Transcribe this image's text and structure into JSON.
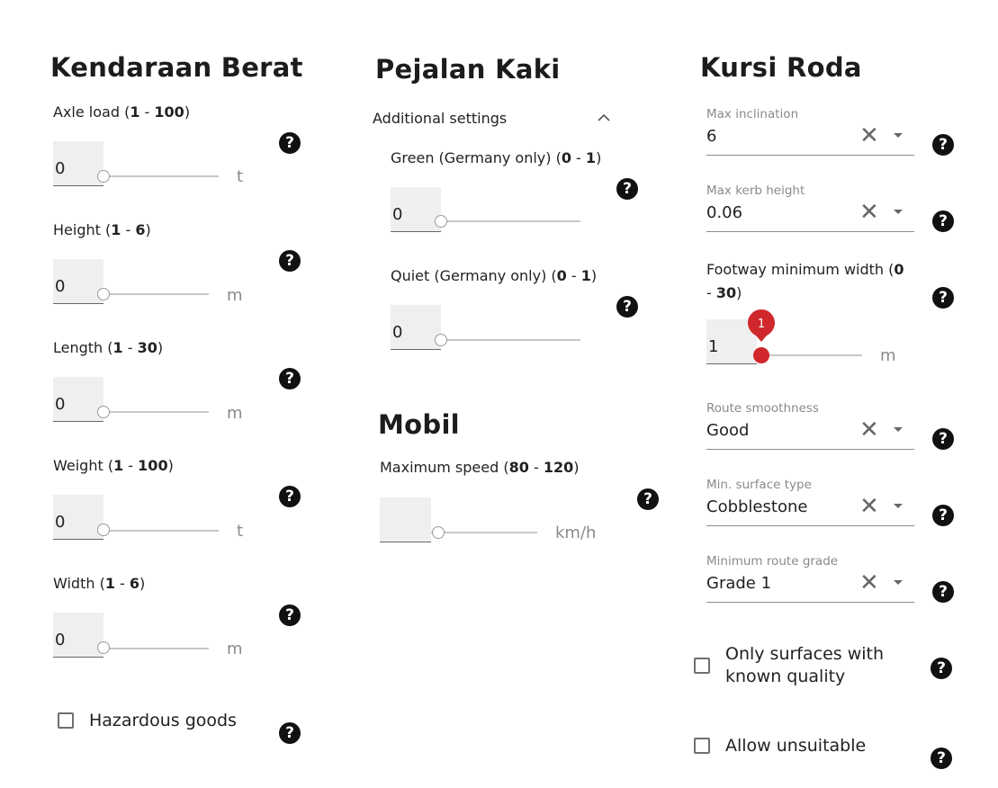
{
  "heavy_vehicle": {
    "title": "Kendaraan Berat",
    "fields": [
      {
        "name": "Axle load",
        "open": " (",
        "min": "1",
        "sep": " - ",
        "max": "100",
        "close": ")",
        "value": "0",
        "unit": "t"
      },
      {
        "name": "Height",
        "open": " (",
        "min": "1",
        "sep": " - ",
        "max": "6",
        "close": ")",
        "value": "0",
        "unit": "m"
      },
      {
        "name": "Length",
        "open": " (",
        "min": "1",
        "sep": " - ",
        "max": "30",
        "close": ")",
        "value": "0",
        "unit": "m"
      },
      {
        "name": "Weight",
        "open": " (",
        "min": "1",
        "sep": " - ",
        "max": "100",
        "close": ")",
        "value": "0",
        "unit": "t"
      },
      {
        "name": "Width",
        "open": " (",
        "min": "1",
        "sep": " - ",
        "max": "6",
        "close": ")",
        "value": "0",
        "unit": "m"
      }
    ],
    "hazardous_label": "Hazardous goods"
  },
  "pedestrian": {
    "title": "Pejalan Kaki",
    "additional_settings": "Additional settings",
    "fields": [
      {
        "name": "Green (Germany only)",
        "open": " (",
        "min": "0",
        "sep": " - ",
        "max": "1",
        "close": ")",
        "value": "0"
      },
      {
        "name": "Quiet (Germany only)",
        "open": " (",
        "min": "0",
        "sep": " - ",
        "max": "1",
        "close": ")",
        "value": "0"
      }
    ]
  },
  "car": {
    "title": "Mobil",
    "field": {
      "name": "Maximum speed",
      "open": " (",
      "min": "80",
      "sep": " - ",
      "max": "120",
      "close": ")",
      "value": "",
      "unit": "km/h"
    }
  },
  "wheelchair": {
    "title": "Kursi Roda",
    "selects": [
      {
        "caption": "Max inclination",
        "value": "6"
      },
      {
        "caption": "Max kerb height",
        "value": "0.06"
      }
    ],
    "footway": {
      "label_line1": "Footway minimum width (",
      "min": "0",
      "sep": " - ",
      "label_line2_prefix": "- ",
      "max": "30",
      "close": ")",
      "value": "1",
      "badge": "1",
      "unit": "m"
    },
    "selects2": [
      {
        "caption": "Route smoothness",
        "value": "Good"
      },
      {
        "caption": "Min. surface type",
        "value": "Cobblestone"
      },
      {
        "caption": "Minimum route grade",
        "value": "Grade 1"
      }
    ],
    "known_quality_line1": "Only surfaces with",
    "known_quality_line2": "known quality",
    "allow_unsuitable": "Allow unsuitable"
  },
  "icons": {
    "help": "?",
    "clear": "✕",
    "accent": "#d0272d"
  }
}
